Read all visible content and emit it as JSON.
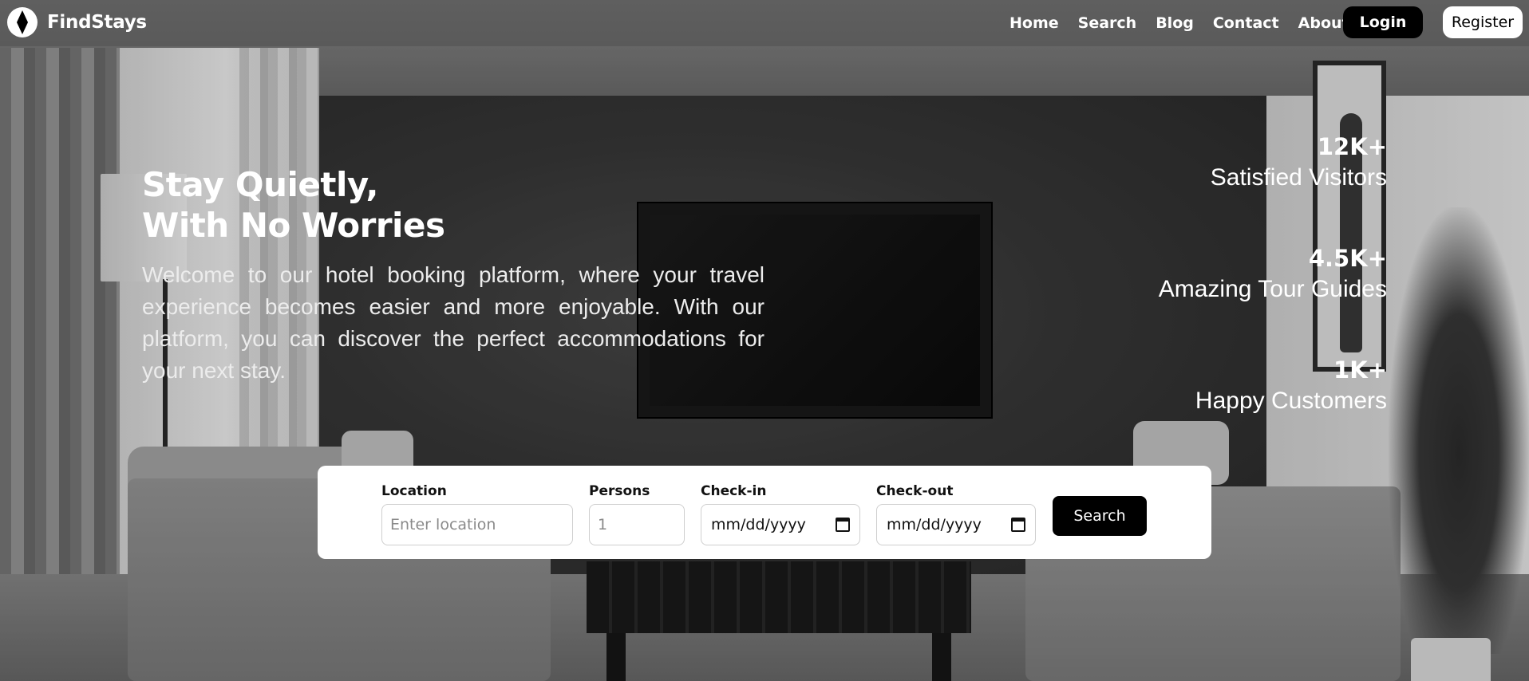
{
  "brand": {
    "name": "FindStays",
    "logo_icon": "compass-diamond-icon"
  },
  "nav": {
    "links": [
      "Home",
      "Search",
      "Blog",
      "Contact",
      "About"
    ],
    "login_label": "Login",
    "register_label": "Register"
  },
  "hero": {
    "title_line1": "Stay Quietly,",
    "title_line2": "With No Worries",
    "description": "Welcome to our hotel booking platform, where your travel experience becomes easier and more enjoyable. With our platform, you can discover the perfect accommodations for your next stay."
  },
  "stats": [
    {
      "value": "12K+",
      "label": "Satisfied Visitors"
    },
    {
      "value": "4.5K+",
      "label": "Amazing Tour Guides"
    },
    {
      "value": "1K+",
      "label": "Happy Customers"
    }
  ],
  "search": {
    "location_label": "Location",
    "location_placeholder": "Enter location",
    "persons_label": "Persons",
    "persons_placeholder": "1",
    "checkin_label": "Check-in",
    "checkin_value": "mm/dd/yyyy",
    "checkout_label": "Check-out",
    "checkout_value": "mm/dd/yyyy",
    "button_label": "Search",
    "calendar_icon": "calendar-icon"
  },
  "colors": {
    "accent": "#000000",
    "text_light": "#ffffff",
    "card_bg": "#ffffff"
  }
}
